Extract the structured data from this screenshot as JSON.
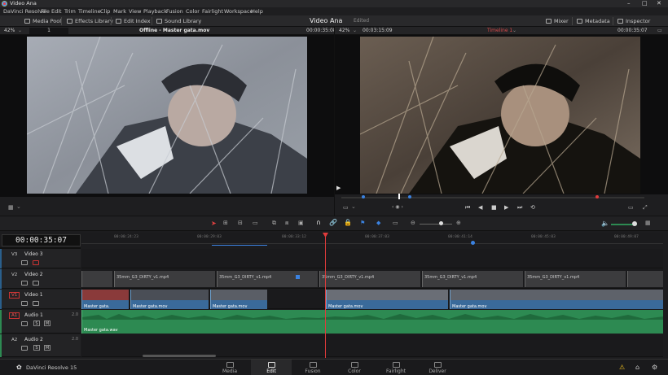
{
  "app": {
    "window_title": "Video Ana",
    "brand": "DaVinci Resolve 15",
    "project_title": "Video Ana",
    "project_state": "Edited"
  },
  "menu": [
    "DaVinci Resolve",
    "File",
    "Edit",
    "Trim",
    "Timeline",
    "Clip",
    "Mark",
    "View",
    "Playback",
    "Fusion",
    "Color",
    "Fairlight",
    "Workspace",
    "Help"
  ],
  "toolbar": {
    "media_pool": "Media Pool",
    "effects_library": "Effects Library",
    "edit_index": "Edit Index",
    "sound_library": "Sound Library",
    "mixer": "Mixer",
    "metadata": "Metadata",
    "inspector": "Inspector"
  },
  "source_viewer": {
    "zoom": "42%",
    "frame": "1",
    "title": "Offline - Master gata.mov",
    "timecode": "00:00:35:08"
  },
  "timeline_viewer": {
    "zoom": "42%",
    "timecode_left": "00:03:15:09",
    "timeline_name": "Timeline 1",
    "timecode_right": "00:00:35:07"
  },
  "timeline": {
    "current_timecode": "00:00:35:07",
    "ruler_labels": [
      "00:00:24:23",
      "00:00:29:03",
      "00:00:33:12",
      "00:00:37:03",
      "00:00:41:14",
      "00:00:45:03",
      "00:00:49:07"
    ],
    "tracks": {
      "v3": {
        "id": "V3",
        "name": "Video 3"
      },
      "v2": {
        "id": "V2",
        "name": "Video 2"
      },
      "v1": {
        "id": "V1",
        "name": "Video 1"
      },
      "a1": {
        "id": "A1",
        "name": "Audio 1",
        "channels": "2.0"
      },
      "a2": {
        "id": "A2",
        "name": "Audio 2",
        "channels": "2.0"
      }
    },
    "v2_clips": [
      "35mm_G3_DIRTY_v1.mp4",
      "35mm_G3_DIRTY_v1.mp4",
      "35mm_G3_DIRTY_v1.mp4",
      "35mm_G3_DIRTY_v1.mp4",
      "35mm_G3_DIRTY_v1.mp4"
    ],
    "v1_clips": [
      "Master gata.",
      "Master gata.mov",
      "Master gata.mov",
      "Master gata.mov",
      "Master gata.mov"
    ],
    "a1_clip": "Master gata.wav",
    "btn_s": "S",
    "btn_m": "M"
  },
  "pages": [
    {
      "label": "Media"
    },
    {
      "label": "Edit"
    },
    {
      "label": "Fusion"
    },
    {
      "label": "Color"
    },
    {
      "label": "Fairlight"
    },
    {
      "label": "Deliver"
    }
  ],
  "colors": {
    "video_clip": "#3a6a9a",
    "audio_clip": "#2d8a52",
    "playhead": "#e03b3b",
    "accent": "#3b82e0"
  }
}
